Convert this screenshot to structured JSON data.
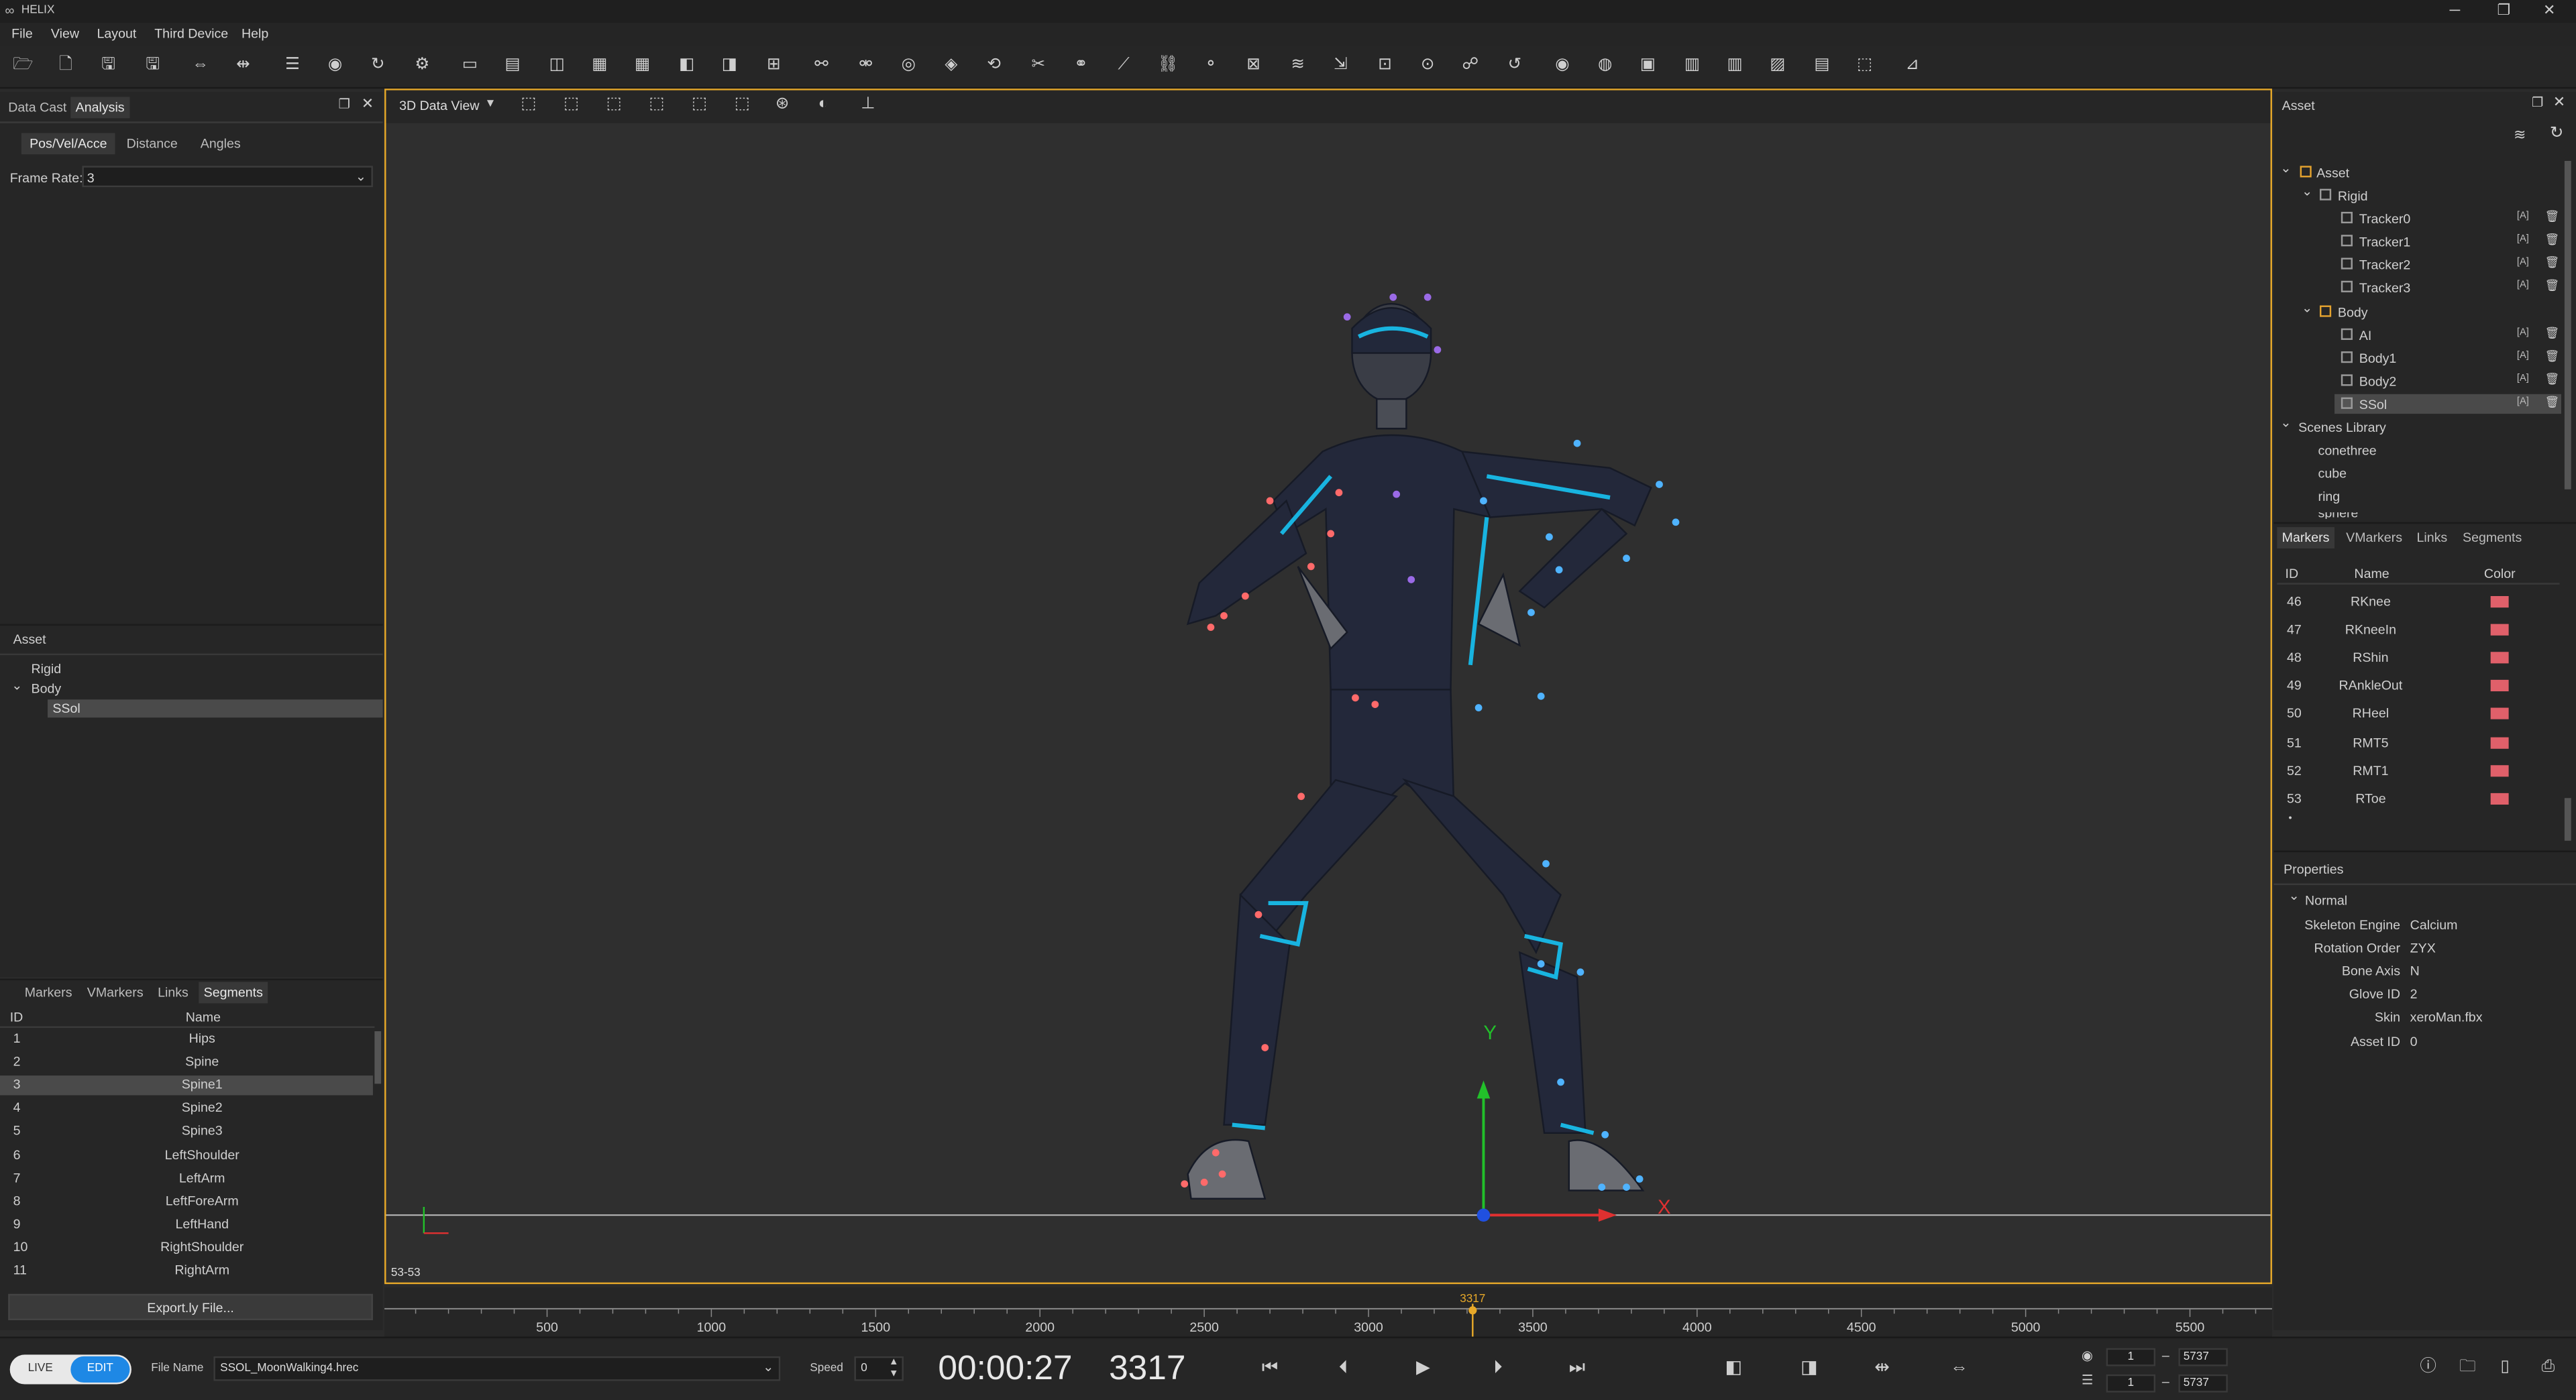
{
  "app": {
    "title": "HELIX"
  },
  "window_controls": {
    "minimize": "─",
    "maximize": "❐",
    "close": "✕"
  },
  "menu": [
    "File",
    "View",
    "Layout",
    "Third Device",
    "Help"
  ],
  "left_panel": {
    "tabs": [
      "Data Cast",
      "Analysis"
    ],
    "sub_tabs": [
      "Pos/Vel/Acce",
      "Distance",
      "Angles"
    ],
    "frame_rate_label": "Frame Rate:",
    "frame_rate_value": "3",
    "asset_header": "Asset",
    "asset_tree": [
      "Rigid",
      "Body",
      "SSol"
    ],
    "bottom_tabs": [
      "Markers",
      "VMarkers",
      "Links",
      "Segments"
    ],
    "table_headers": [
      "ID",
      "Name"
    ],
    "segments": [
      {
        "id": "1",
        "name": "Hips"
      },
      {
        "id": "2",
        "name": "Spine"
      },
      {
        "id": "3",
        "name": "Spine1"
      },
      {
        "id": "4",
        "name": "Spine2"
      },
      {
        "id": "5",
        "name": "Spine3"
      },
      {
        "id": "6",
        "name": "LeftShoulder"
      },
      {
        "id": "7",
        "name": "LeftArm"
      },
      {
        "id": "8",
        "name": "LeftForeArm"
      },
      {
        "id": "9",
        "name": "LeftHand"
      },
      {
        "id": "10",
        "name": "RightShoulder"
      },
      {
        "id": "11",
        "name": "RightArm"
      }
    ],
    "export_label": "Export.ly File..."
  },
  "viewport": {
    "mode_label": "3D Data View",
    "frame_range": "53-53",
    "axis_y": "Y",
    "axis_x": "X"
  },
  "right_panel": {
    "header": "Asset",
    "tree": {
      "asset": "Asset",
      "rigid": "Rigid",
      "trackers": [
        "Tracker0",
        "Tracker1",
        "Tracker2",
        "Tracker3"
      ],
      "body": "Body",
      "bodies": [
        "AI",
        "Body1",
        "Body2",
        "SSol"
      ],
      "scenes_library": "Scenes Library",
      "scenes": [
        "conethree",
        "cube",
        "ring",
        "sphere"
      ],
      "row_badge": "[A]"
    },
    "tabs": [
      "Markers",
      "VMarkers",
      "Links",
      "Segments"
    ],
    "marker_headers": [
      "ID",
      "Name",
      "Color"
    ],
    "markers": [
      {
        "id": "46",
        "name": "RKnee"
      },
      {
        "id": "47",
        "name": "RKneeIn"
      },
      {
        "id": "48",
        "name": "RShin"
      },
      {
        "id": "49",
        "name": "RAnkleOut"
      },
      {
        "id": "50",
        "name": "RHeel"
      },
      {
        "id": "51",
        "name": "RMT5"
      },
      {
        "id": "52",
        "name": "RMT1"
      },
      {
        "id": "53",
        "name": "RToe"
      }
    ],
    "marker_color": "#e0606a",
    "properties_header": "Properties",
    "properties_group": "Normal",
    "properties": [
      {
        "label": "Skeleton Engine",
        "value": "Calcium"
      },
      {
        "label": "Rotation Order",
        "value": "ZYX"
      },
      {
        "label": "Bone Axis",
        "value": "N"
      },
      {
        "label": "Glove ID",
        "value": "2"
      },
      {
        "label": "Skin",
        "value": "xeroMan.fbx"
      },
      {
        "label": "Asset ID",
        "value": "0"
      }
    ]
  },
  "timeline": {
    "ticks": [
      "500",
      "1000",
      "1500",
      "2000",
      "2500",
      "3000",
      "3500",
      "4000",
      "4500",
      "5000",
      "5500"
    ],
    "cursor_label": "3317"
  },
  "transport": {
    "live_label": "LIVE",
    "edit_label": "EDIT",
    "file_name_label": "File Name",
    "file_name": "SSOL_MoonWalking4.hrec",
    "speed_label": "Speed",
    "speed_value": "0",
    "time": "00:00:27",
    "frame": "3317",
    "range1_start": "1",
    "range1_end": "5737",
    "range2_start": "1",
    "range2_end": "5737",
    "dash": "–"
  },
  "colors": {
    "accent": "#e6a829",
    "edit_blue": "#1e88e5",
    "suit_cyan": "#18b4e0"
  }
}
